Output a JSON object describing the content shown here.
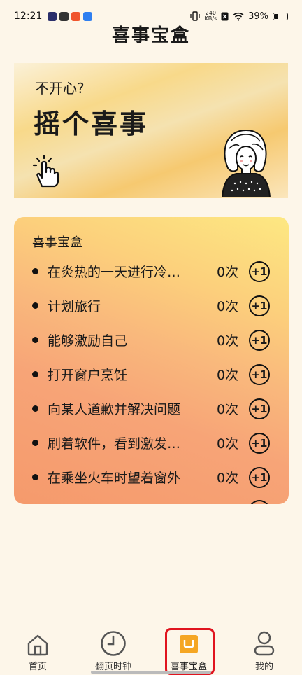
{
  "status_bar": {
    "time": "12:21",
    "net_speed_value": "240",
    "net_speed_unit": "KB/s",
    "battery": "39%"
  },
  "page_title": "喜事宝盒",
  "banner": {
    "subtitle": "不开心?",
    "title": "摇个喜事"
  },
  "box": {
    "title": "喜事宝盒",
    "plus_label": "+1",
    "items": [
      {
        "text": "在炎热的一天进行冷…",
        "count": "0次"
      },
      {
        "text": "计划旅行",
        "count": "0次"
      },
      {
        "text": "能够激励自己",
        "count": "0次"
      },
      {
        "text": "打开窗户烹饪",
        "count": "0次"
      },
      {
        "text": "向某人道歉并解决问题",
        "count": "0次"
      },
      {
        "text": "刷着软件，看到激发…",
        "count": "0次"
      },
      {
        "text": "在乘坐火车时望着窗外",
        "count": "0次"
      }
    ]
  },
  "nav": {
    "items": [
      {
        "label": "首页",
        "icon": "home-icon"
      },
      {
        "label": "翻页时钟",
        "icon": "clock-icon"
      },
      {
        "label": "喜事宝盒",
        "icon": "box-icon",
        "active": true
      },
      {
        "label": "我的",
        "icon": "person-icon"
      }
    ],
    "active_color": "#f5a623"
  }
}
